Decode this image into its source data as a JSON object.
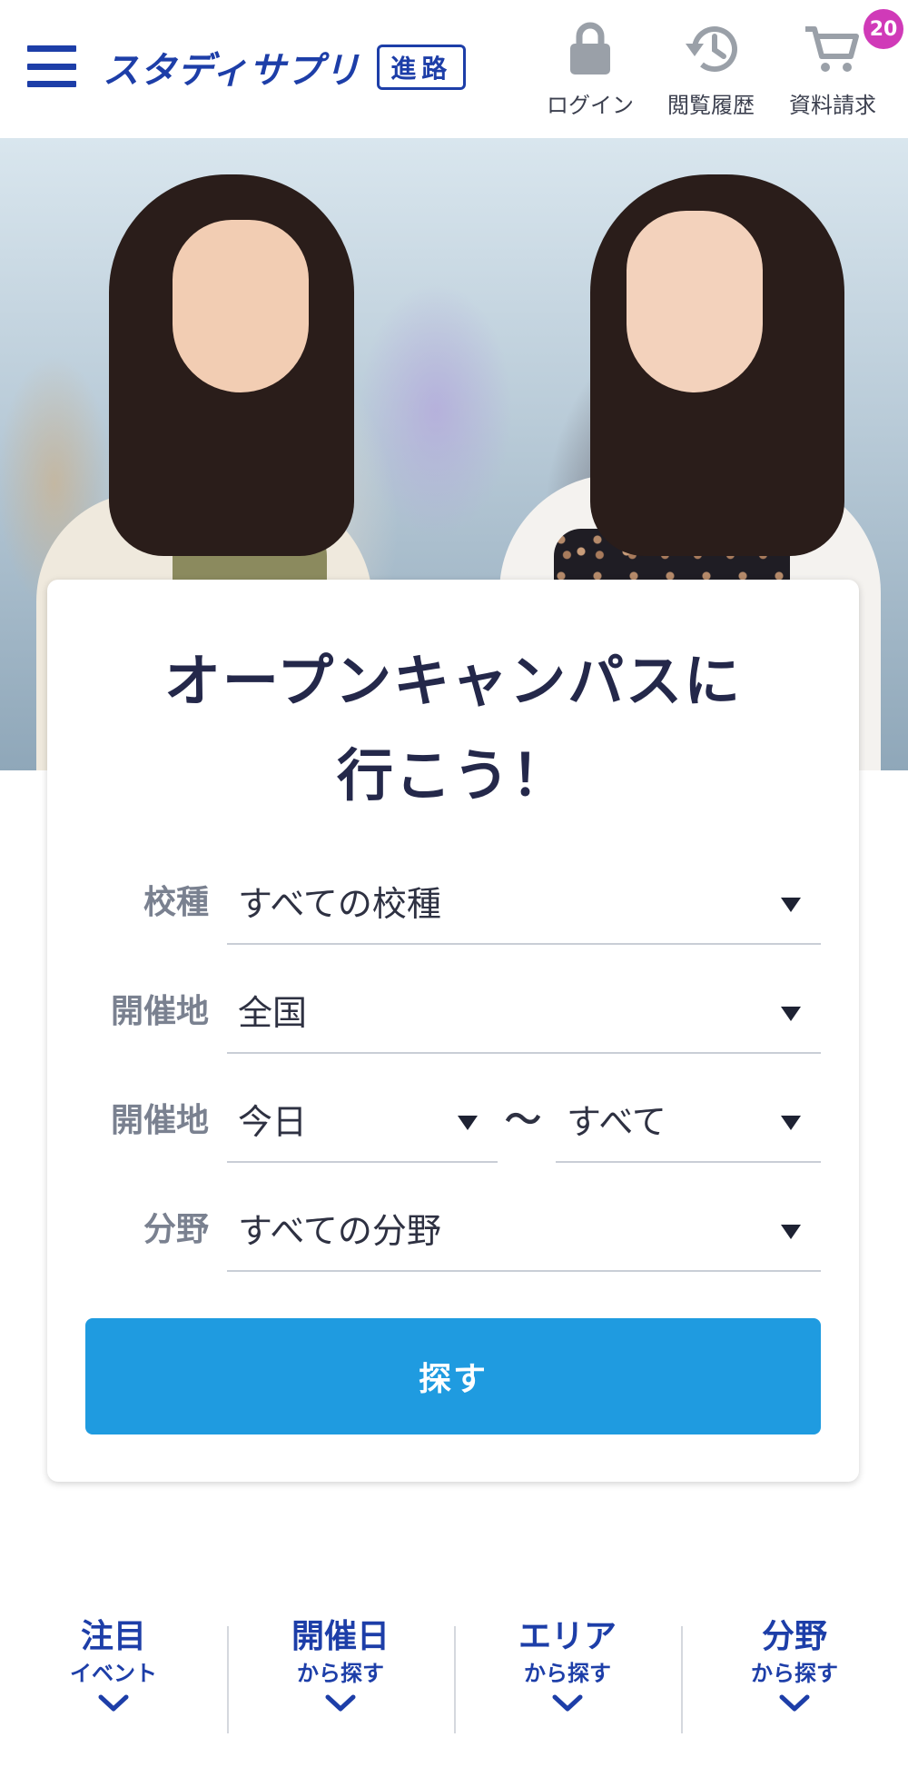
{
  "header": {
    "logo_text": "スタディサプリ",
    "logo_badge": "進路",
    "login_label": "ログイン",
    "history_label": "閲覧履歴",
    "request_label": "資料請求",
    "cart_count": "20"
  },
  "search": {
    "title_line1": "オープンキャンパスに",
    "title_line2": "行こう！",
    "school_type": {
      "label": "校種",
      "value": "すべての校種"
    },
    "location": {
      "label": "開催地",
      "value": "全国"
    },
    "date": {
      "label": "開催地",
      "from_value": "今日",
      "separator": "〜",
      "to_value": "すべて"
    },
    "field": {
      "label": "分野",
      "value": "すべての分野"
    },
    "submit_label": "探す"
  },
  "bottom_nav": [
    {
      "main": "注目",
      "sub": "イベント"
    },
    {
      "main": "開催日",
      "sub": "から探す"
    },
    {
      "main": "エリア",
      "sub": "から探す"
    },
    {
      "main": "分野",
      "sub": "から探す"
    }
  ],
  "colors": {
    "brand_blue": "#1d3ea8",
    "button_blue": "#1f9be0",
    "badge_magenta": "#d03ab8"
  }
}
